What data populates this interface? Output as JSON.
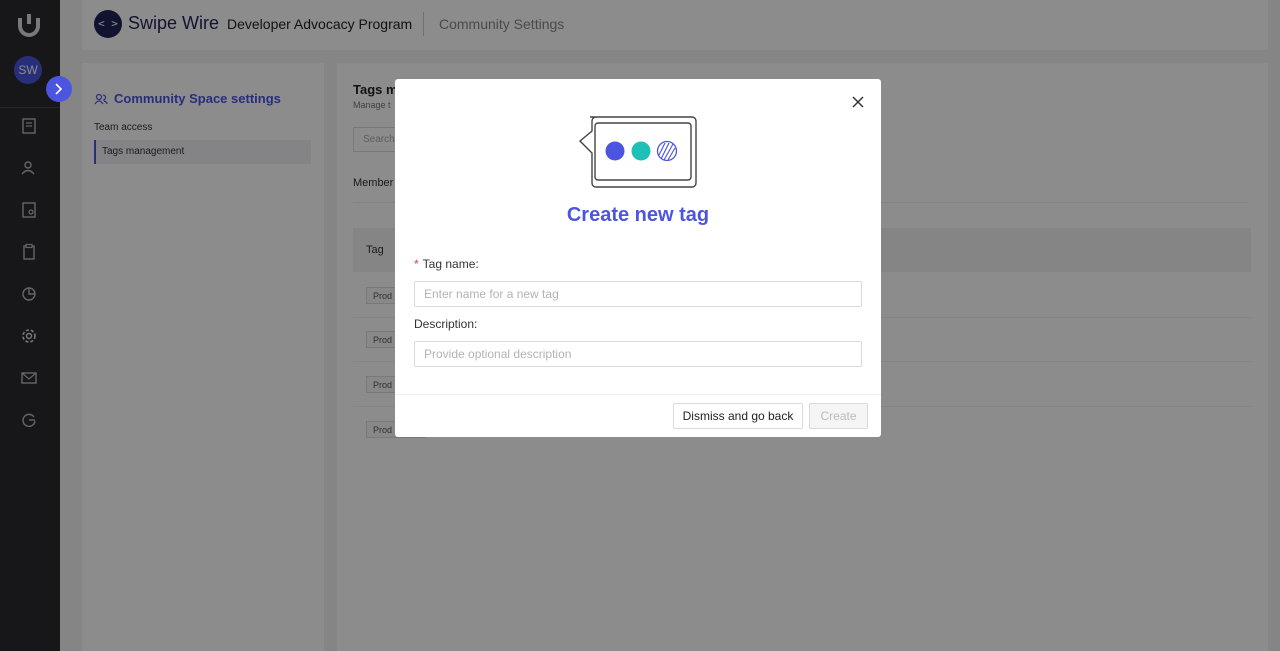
{
  "rail": {
    "avatar_initials": "SW",
    "nav_icons": [
      "reports-icon",
      "members-icon",
      "profile-doc-icon",
      "clipboard-icon",
      "analytics-icon",
      "settings-icon",
      "mail-icon",
      "integration-icon"
    ]
  },
  "topbar": {
    "brand_badge": "< >",
    "brand_name": "Swipe Wire",
    "program": "Developer Advocacy Program",
    "breadcrumb": "Community Settings"
  },
  "settings_panel": {
    "title": "Community Space settings",
    "items": [
      "Team access",
      "Tags management"
    ]
  },
  "main_panel": {
    "title": "Tags m",
    "subtitle": "Manage t",
    "search_placeholder": "Search",
    "members_label": "Member",
    "table_header_tag": "Tag",
    "row_tags": [
      "Prod",
      "Prod",
      "Prod",
      "Prod"
    ]
  },
  "modal": {
    "title": "Create new tag",
    "tag_name_label": "Tag name",
    "tag_name_placeholder": "Enter name for a new tag",
    "description_label": "Description",
    "description_placeholder": "Provide optional description",
    "dismiss_label": "Dismiss and go back",
    "create_label": "Create",
    "colors": {
      "accent": "#4b55e0",
      "teal": "#1fc1b6"
    }
  }
}
